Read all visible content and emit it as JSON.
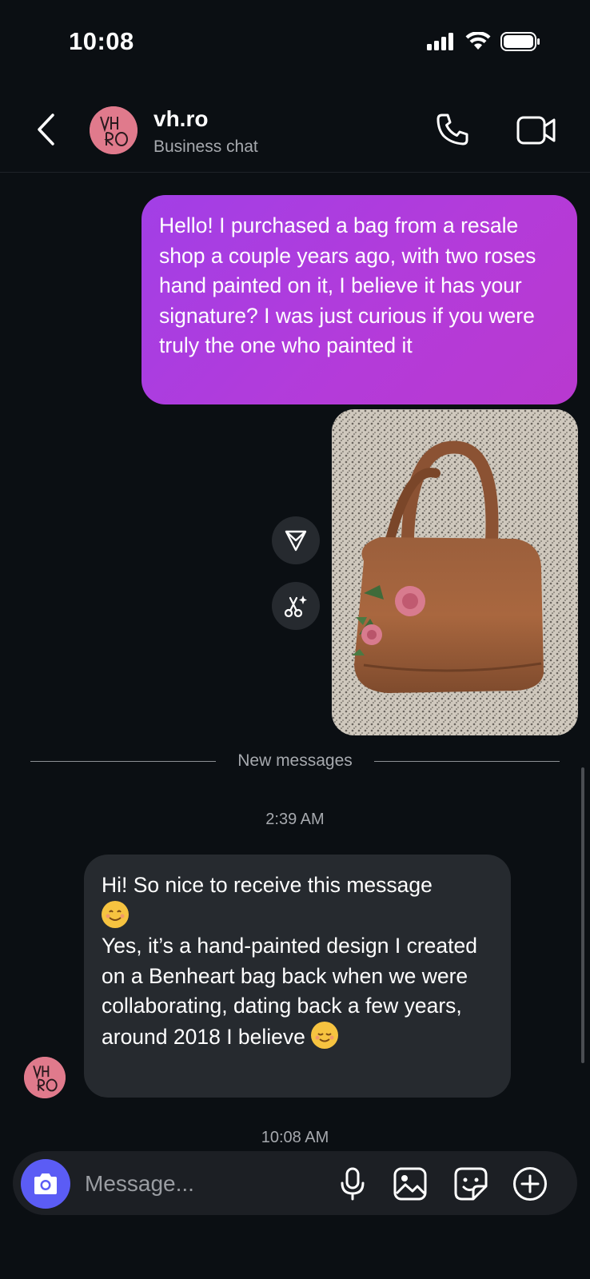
{
  "status_bar": {
    "time": "10:08"
  },
  "header": {
    "contact_name": "vh.ro",
    "subtitle": "Business chat",
    "avatar_monogram": "VH RO"
  },
  "messages": {
    "outgoing_text": "Hello! I purchased a bag from a resale shop a couple years ago, with two roses hand painted on it, I believe it has your signature? I was just curious if you were truly the one who painted it",
    "photo_icon": "handbag-photo",
    "new_messages_label": "New messages",
    "timestamp_1": "2:39 AM",
    "incoming_line_1": "Hi! So nice to receive this message",
    "incoming_rest": "Yes, it’s a hand-painted design I created on a Benheart bag back when we were collaborating, dating back a few years, around 2018 I believe",
    "timestamp_2": "10:08 AM"
  },
  "composer": {
    "placeholder": "Message..."
  },
  "colors": {
    "background": "#0b0f13",
    "outgoing_bubble": "#a23fe6",
    "incoming_bubble": "#262a2f",
    "camera_button": "#5b5cf5"
  }
}
